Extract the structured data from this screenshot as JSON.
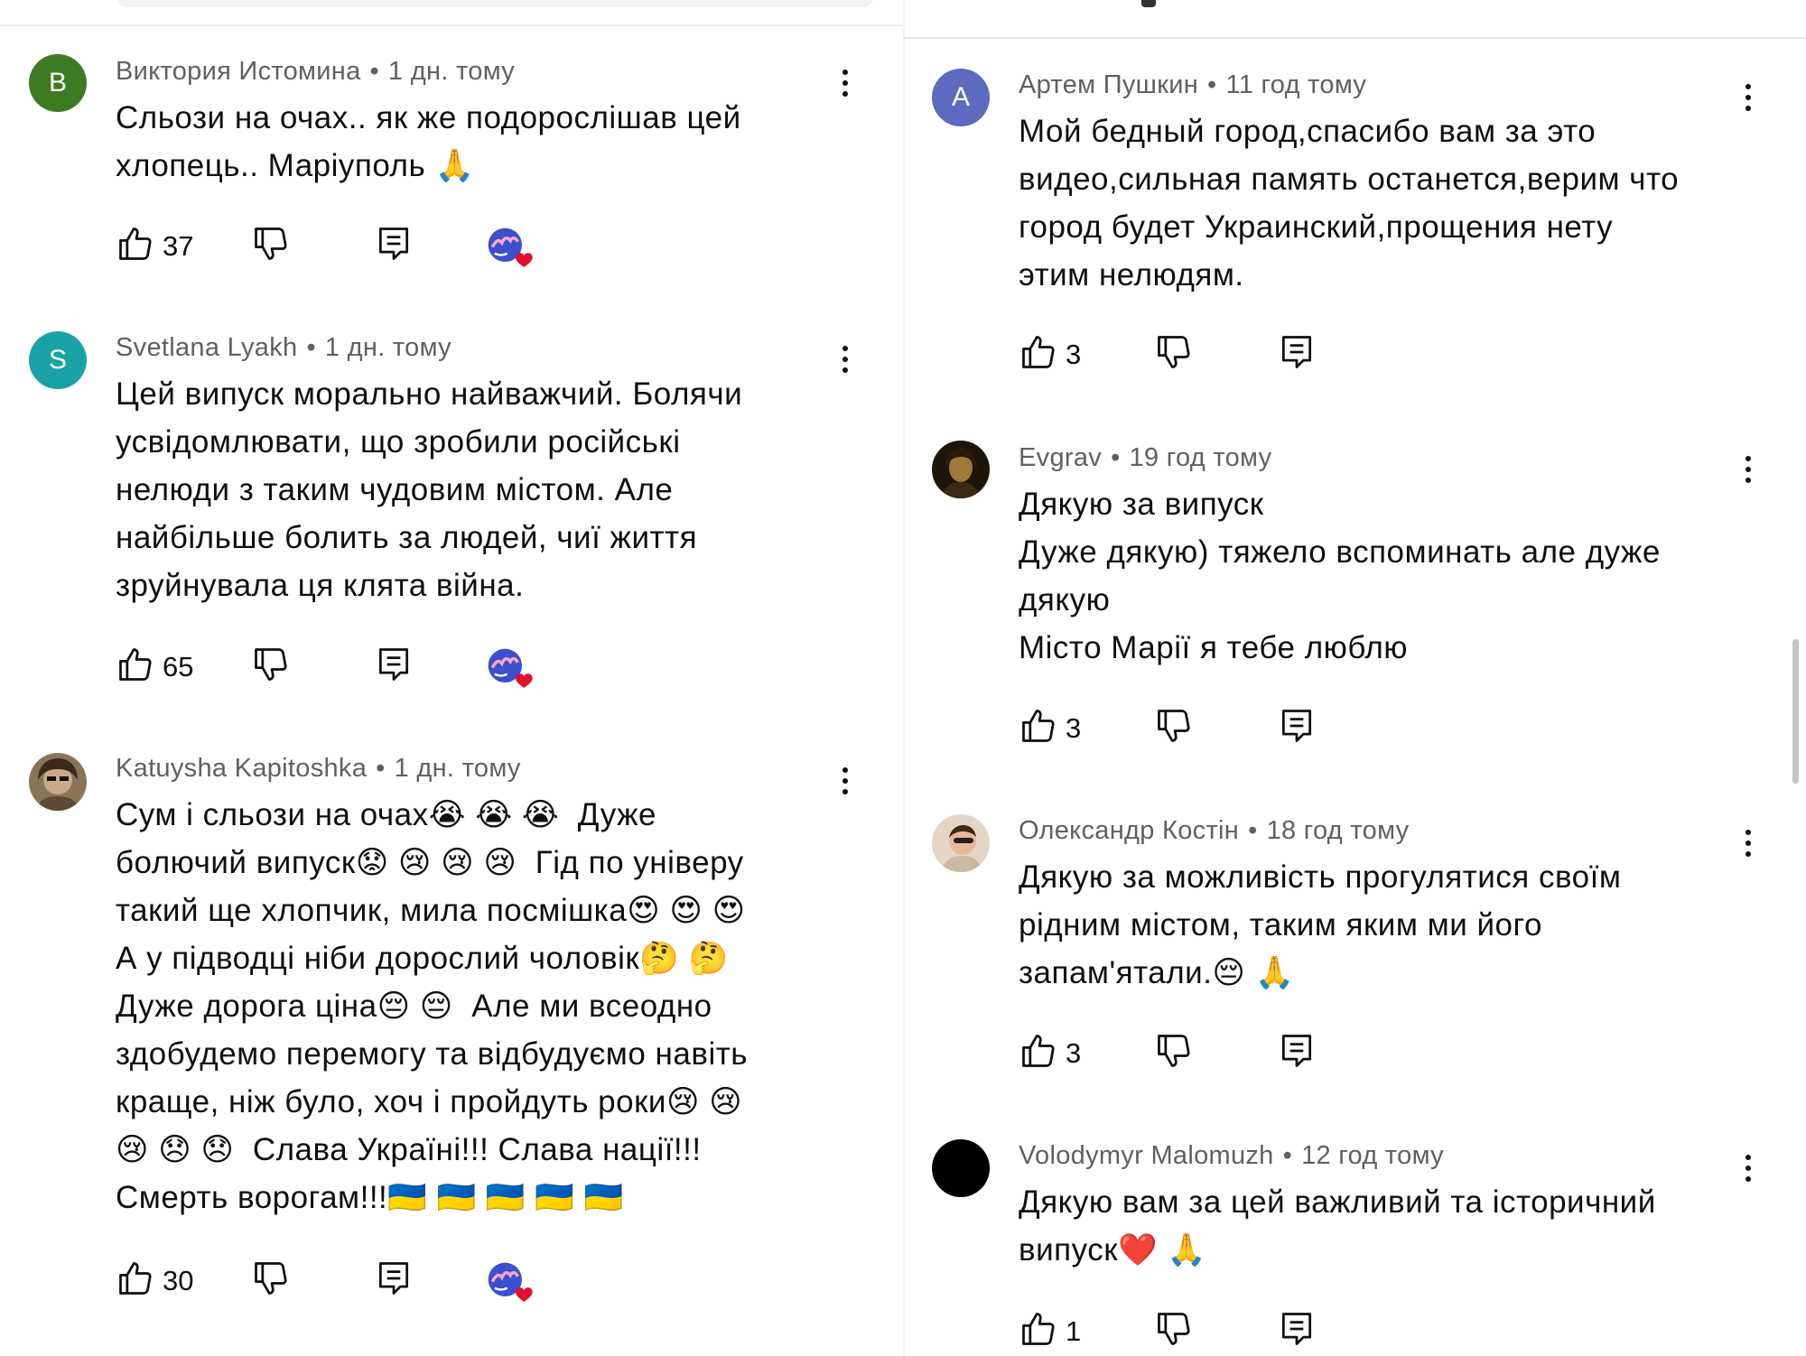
{
  "left_comments": [
    {
      "author": "Виктория Истомина",
      "time": "1 дн. тому",
      "avatar_letter": "В",
      "avatar_color": "#3e7a21",
      "text": "Сльози на очах.. як же подорослішав цей\nхлопець.. Маріуполь 🙏",
      "likes": "37",
      "creator_heart": true
    },
    {
      "author": "Svetlana Lyakh",
      "time": "1 дн. тому",
      "avatar_letter": "S",
      "avatar_color": "#1aa3a6",
      "text": "Цей випуск морально найважчий. Болячи\nусвідомлювати, що зробили російські\nнелюди з таким чудовим містом. Але\nнайбільше болить за людей, чиї життя\nзруйнувала ця клята війна.",
      "likes": "65",
      "creator_heart": true
    },
    {
      "author": "Katuysha Kapitoshka",
      "time": "1 дн. тому",
      "avatar_letter": "",
      "avatar_color": "#6b5a45",
      "text": "Сум і сльози на очах😭 😭 😭  Дуже\nболючий випуск😟 😢 😢 😢  Гід по універу\nтакий ще хлопчик, мила посмішка😍 😍 😍\nА у підводці ніби дорослий чоловік🤔 🤔\nДуже дорога ціна😔 😔  Але ми всеодно\nздобудемо перемогу та відбудуємо навіть\nкраще, ніж було, хоч і пройдуть роки😢 😢\n😢 😞 😞  Слава Україні!!! Слава нації!!!\nСмерть ворогам!!!🇺🇦 🇺🇦 🇺🇦 🇺🇦 🇺🇦",
      "likes": "30",
      "creator_heart": true
    }
  ],
  "right_comments": [
    {
      "author": "Артем Пушкин",
      "time": "11 год тому",
      "avatar_letter": "А",
      "avatar_color": "#5c6bc0",
      "text": "Мой бедный город,спасибо вам за это\nвидео,сильная память останется,верим что\nгород будет Украинский,прощения нету\nэтим нелюдям.",
      "likes": "3"
    },
    {
      "author": "Evgrav",
      "time": "19 год тому",
      "avatar_letter": "",
      "avatar_color": "#4a3a1c",
      "text": "Дякую за випуск\nДуже дякую) тяжело вспоминать але дуже\nдякую\nМісто Марії я тебе люблю",
      "likes": "3"
    },
    {
      "author": "Олександр Костін",
      "time": "18 год тому",
      "avatar_letter": "",
      "avatar_color": "#d9c9b4",
      "text": "Дякую за можливість прогулятися своїм\nрідним містом, таким яким ми його\nзапам'ятали.😔 🙏",
      "likes": "3"
    },
    {
      "author": "Volodymyr Malomuzh",
      "time": "12 год тому",
      "avatar_letter": "",
      "avatar_color": "#000000",
      "text": "Дякую вам за цей важливий та історичний\nвипуск❤️ 🙏",
      "likes": "1"
    }
  ],
  "separator": "•",
  "icons": {
    "like": "thumb-up-icon",
    "dislike": "thumb-down-icon",
    "reply": "reply-comment-icon",
    "more": "more-vert-icon",
    "heart": "creator-heart-icon"
  },
  "colors": {
    "text": "#0f0f0f",
    "meta": "#606060",
    "heart": "#e0102a"
  }
}
